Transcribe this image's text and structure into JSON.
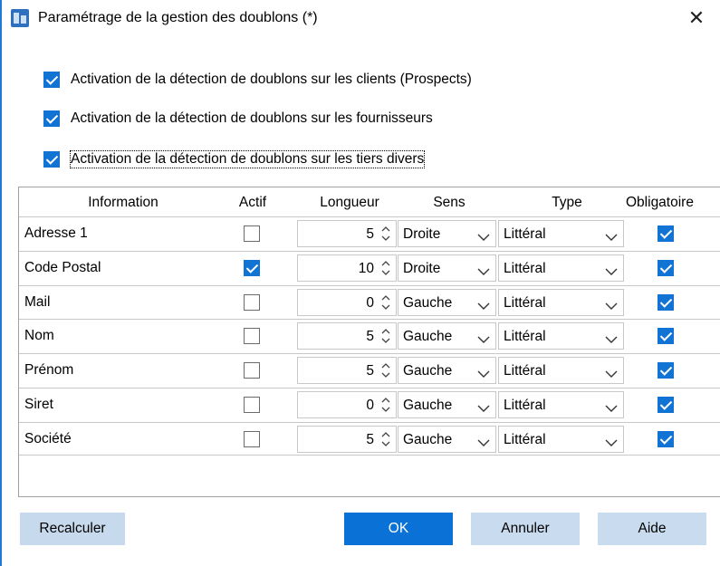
{
  "window": {
    "title": "Paramétrage de la gestion des doublons (*)",
    "close_glyph": "✕",
    "app_icon": "app-window-icon"
  },
  "options": [
    {
      "label": "Activation de la détection de doublons sur les clients (Prospects)",
      "checked": true
    },
    {
      "label": "Activation de la détection de doublons sur les fournisseurs",
      "checked": true
    },
    {
      "label": "Activation de la détection de doublons sur les tiers divers",
      "checked": true
    }
  ],
  "grid": {
    "headers": {
      "information": "Information",
      "actif": "Actif",
      "longueur": "Longueur",
      "sens": "Sens",
      "type": "Type",
      "obligatoire": "Obligatoire"
    },
    "rows": [
      {
        "information": "Adresse 1",
        "actif": false,
        "longueur": "5",
        "sens": "Droite",
        "type": "Littéral",
        "obligatoire": true
      },
      {
        "information": "Code Postal",
        "actif": true,
        "longueur": "10",
        "sens": "Droite",
        "type": "Littéral",
        "obligatoire": true
      },
      {
        "information": "Mail",
        "actif": false,
        "longueur": "0",
        "sens": "Gauche",
        "type": "Littéral",
        "obligatoire": true
      },
      {
        "information": "Nom",
        "actif": false,
        "longueur": "5",
        "sens": "Gauche",
        "type": "Littéral",
        "obligatoire": true
      },
      {
        "information": "Prénom",
        "actif": false,
        "longueur": "5",
        "sens": "Gauche",
        "type": "Littéral",
        "obligatoire": true
      },
      {
        "information": "Siret",
        "actif": false,
        "longueur": "0",
        "sens": "Gauche",
        "type": "Littéral",
        "obligatoire": true
      },
      {
        "information": "Société",
        "actif": false,
        "longueur": "5",
        "sens": "Gauche",
        "type": "Littéral",
        "obligatoire": true
      }
    ]
  },
  "buttons": {
    "recalculer": "Recalculer",
    "ok": "OK",
    "annuler": "Annuler",
    "aide": "Aide"
  },
  "colors": {
    "accent": "#1173d4",
    "primary_button": "#0a72d6",
    "secondary_button": "#c7d9ec"
  }
}
